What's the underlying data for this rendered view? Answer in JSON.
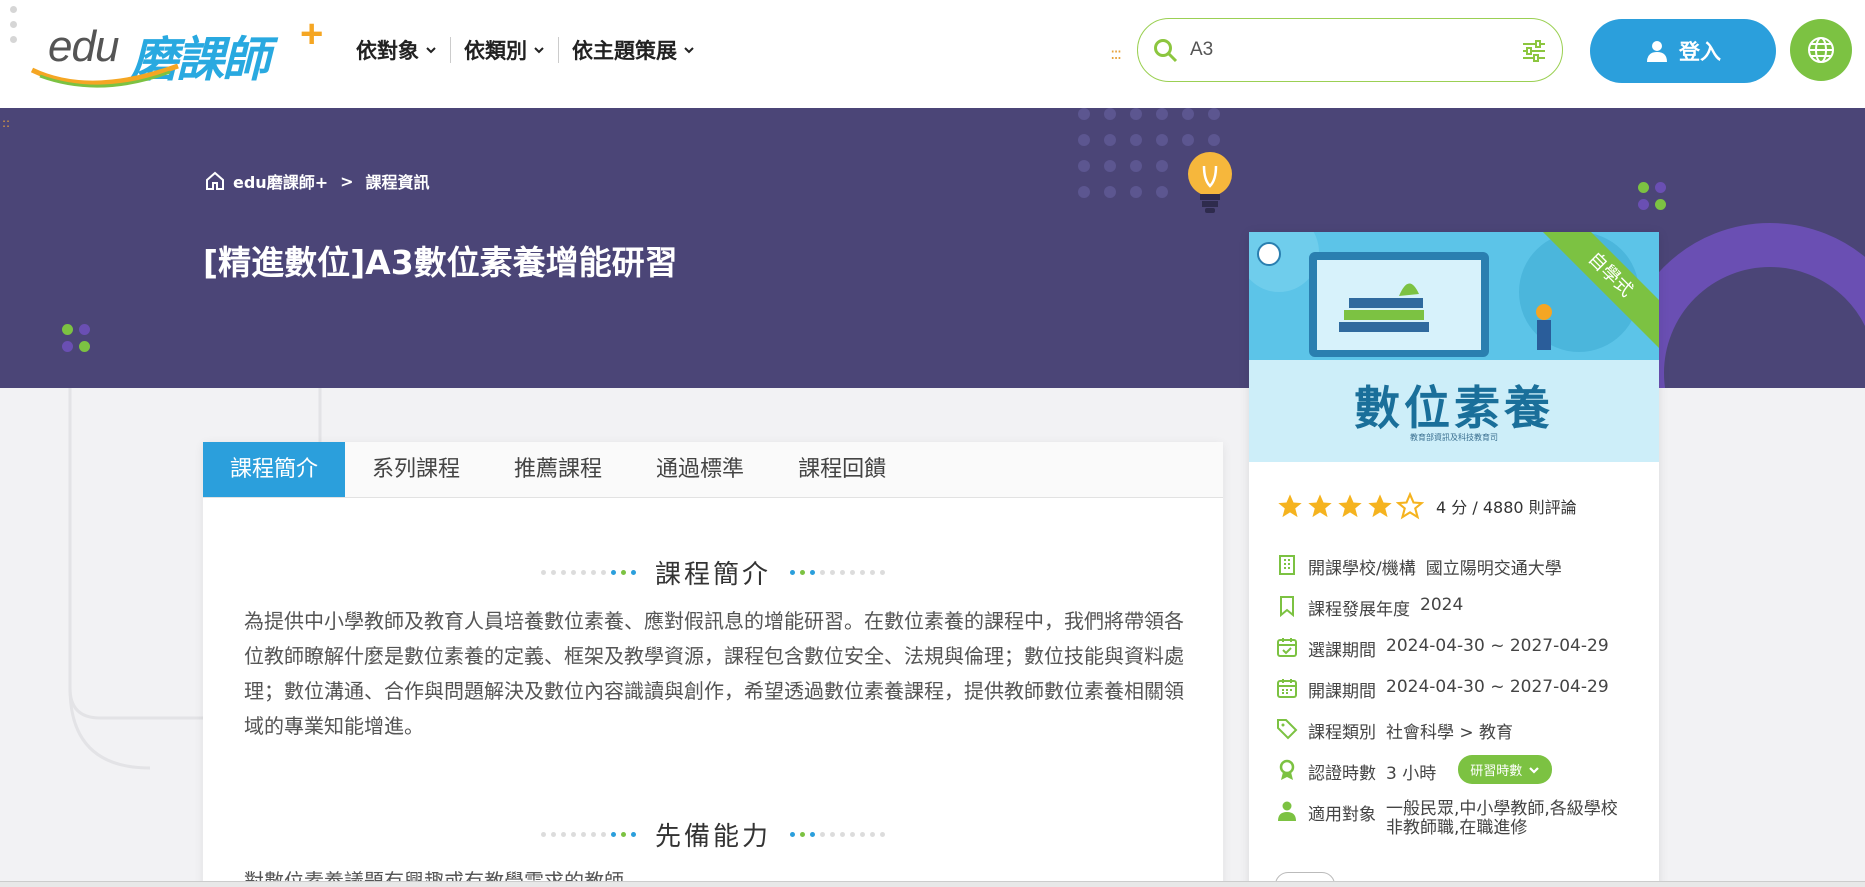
{
  "header": {
    "logo_edu": "edu",
    "logo_main": "磨課師",
    "logo_plus": "+",
    "nav": [
      {
        "label": "依對象"
      },
      {
        "label": "依類別"
      },
      {
        "label": "依主題策展"
      }
    ],
    "search": {
      "value": "A3",
      "placeholder": ""
    },
    "login_label": "登入",
    "icons": {
      "search": "search-icon",
      "filter": "sliders-icon",
      "user": "user-icon",
      "globe": "globe-icon"
    },
    "colors": {
      "brand_blue": "#2b9fdc",
      "brand_green": "#7cc242",
      "search_border": "#9bd053"
    }
  },
  "banner": {
    "breadcrumb": [
      {
        "label": "edu磨課師+"
      },
      {
        "label": "課程資訊"
      }
    ],
    "breadcrumb_sep": ">",
    "title": "[精進數位]A3數位素養增能研習",
    "color": "#4b4577"
  },
  "tabs": [
    {
      "label": "課程簡介",
      "active": true
    },
    {
      "label": "系列課程",
      "active": false
    },
    {
      "label": "推薦課程",
      "active": false
    },
    {
      "label": "通過標準",
      "active": false
    },
    {
      "label": "課程回饋",
      "active": false
    }
  ],
  "sections": {
    "intro_title": "課程簡介",
    "intro_text": "為提供中小學教師及教育人員培養數位素養、應對假訊息的增能研習。在數位素養的課程中，我們將帶領各位教師瞭解什麼是數位素養的定義、框架及教學資源，課程包含數位安全、法規與倫理；數位技能與資料處理；數位溝通、合作與問題解決及數位內容識讀與創作，希望透過數位素養課程，提供教師數位素養相關領域的專業知能增進。",
    "prereq_title": "先備能力",
    "prereq_text": "對數位素養議題有興趣或有教學需求的教師"
  },
  "course_card": {
    "cover_title": "數位素養",
    "cover_subtitle": "教育部資訊及科技教育司",
    "ribbon": "自學式",
    "rating_value": 4,
    "rating_max": 5,
    "rating_text": "4 分 / 4880 則評論",
    "info": [
      {
        "icon": "building-icon",
        "label": "開課學校/機構",
        "value": "國立陽明交通大學"
      },
      {
        "icon": "bookmark-icon",
        "label": "課程發展年度",
        "value": "2024"
      },
      {
        "icon": "calendar-check-icon",
        "label": "選課期間",
        "value": "2024-04-30 ~ 2027-04-29"
      },
      {
        "icon": "calendar-icon",
        "label": "開課期間",
        "value": "2024-04-30 ~ 2027-04-29"
      },
      {
        "icon": "tag-icon",
        "label": "課程類別",
        "value": "社會科學 > 教育"
      },
      {
        "icon": "award-icon",
        "label": "認證時數",
        "value": "3 小時",
        "pill": "研習時數"
      },
      {
        "icon": "person-icon",
        "label": "適用對象",
        "value_line1": "一般民眾,中小學教師,各級學校",
        "value_line2": "非教師職,在職進修"
      }
    ]
  }
}
